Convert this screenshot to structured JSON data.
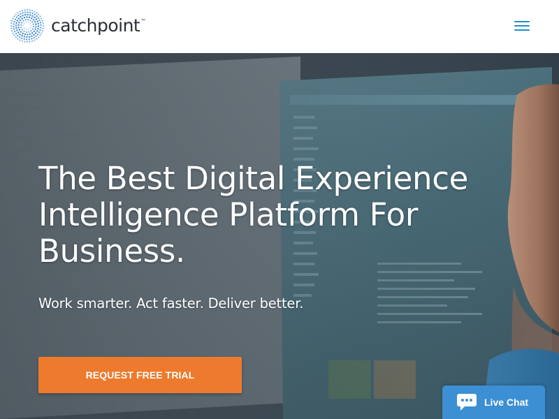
{
  "header": {
    "logo_text": "catchpoint",
    "logo_tm": "™",
    "menu_icon": "hamburger-menu-icon",
    "accent_color": "#1f8dc9"
  },
  "hero": {
    "headline": "The Best Digital Experience Intelligence Platform For Business.",
    "subheadline": "Work smarter. Act faster. Deliver better.",
    "cta_label": "REQUEST FREE TRIAL",
    "cta_color": "#ee7a2e"
  },
  "live_chat": {
    "label": "Live Chat",
    "icon": "chat-bubble-icon",
    "color": "#3d8fd4"
  }
}
